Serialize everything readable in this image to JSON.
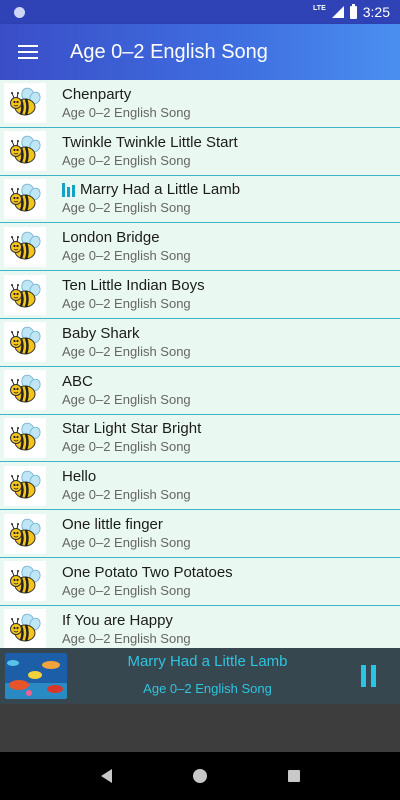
{
  "status_bar": {
    "time": "3:25",
    "network": "LTE"
  },
  "app_bar": {
    "title": "Age 0–2 English Song",
    "menu_icon": "hamburger-menu-icon"
  },
  "songs": [
    {
      "title": "Chenparty",
      "subtitle": "Age 0–2 English Song",
      "playing": false
    },
    {
      "title": "Twinkle Twinkle Little Start",
      "subtitle": "Age 0–2 English Song",
      "playing": false
    },
    {
      "title": "Marry Had a Little Lamb",
      "subtitle": "Age 0–2 English Song",
      "playing": true
    },
    {
      "title": "London Bridge",
      "subtitle": "Age 0–2 English Song",
      "playing": false
    },
    {
      "title": "Ten Little Indian Boys",
      "subtitle": "Age 0–2 English Song",
      "playing": false
    },
    {
      "title": "Baby Shark",
      "subtitle": "Age 0–2 English Song",
      "playing": false
    },
    {
      "title": "ABC",
      "subtitle": "Age 0–2 English Song",
      "playing": false
    },
    {
      "title": "Star Light Star Bright",
      "subtitle": "Age 0–2 English Song",
      "playing": false
    },
    {
      "title": "Hello",
      "subtitle": "Age 0–2 English Song",
      "playing": false
    },
    {
      "title": "One little finger",
      "subtitle": "Age 0–2 English Song",
      "playing": false
    },
    {
      "title": "One Potato Two Potatoes",
      "subtitle": "Age 0–2 English Song",
      "playing": false
    },
    {
      "title": "If You are Happy",
      "subtitle": "Age 0–2 English Song",
      "playing": false
    }
  ],
  "now_playing": {
    "title": "Marry Had a Little Lamb",
    "subtitle": "Age 0–2 English Song",
    "state_icon": "pause-icon"
  },
  "colors": {
    "accent": "#29c4e6",
    "list_bg": "#e9f8f0",
    "divider": "#3fb4c8",
    "app_bar": "#3a4ec8"
  }
}
